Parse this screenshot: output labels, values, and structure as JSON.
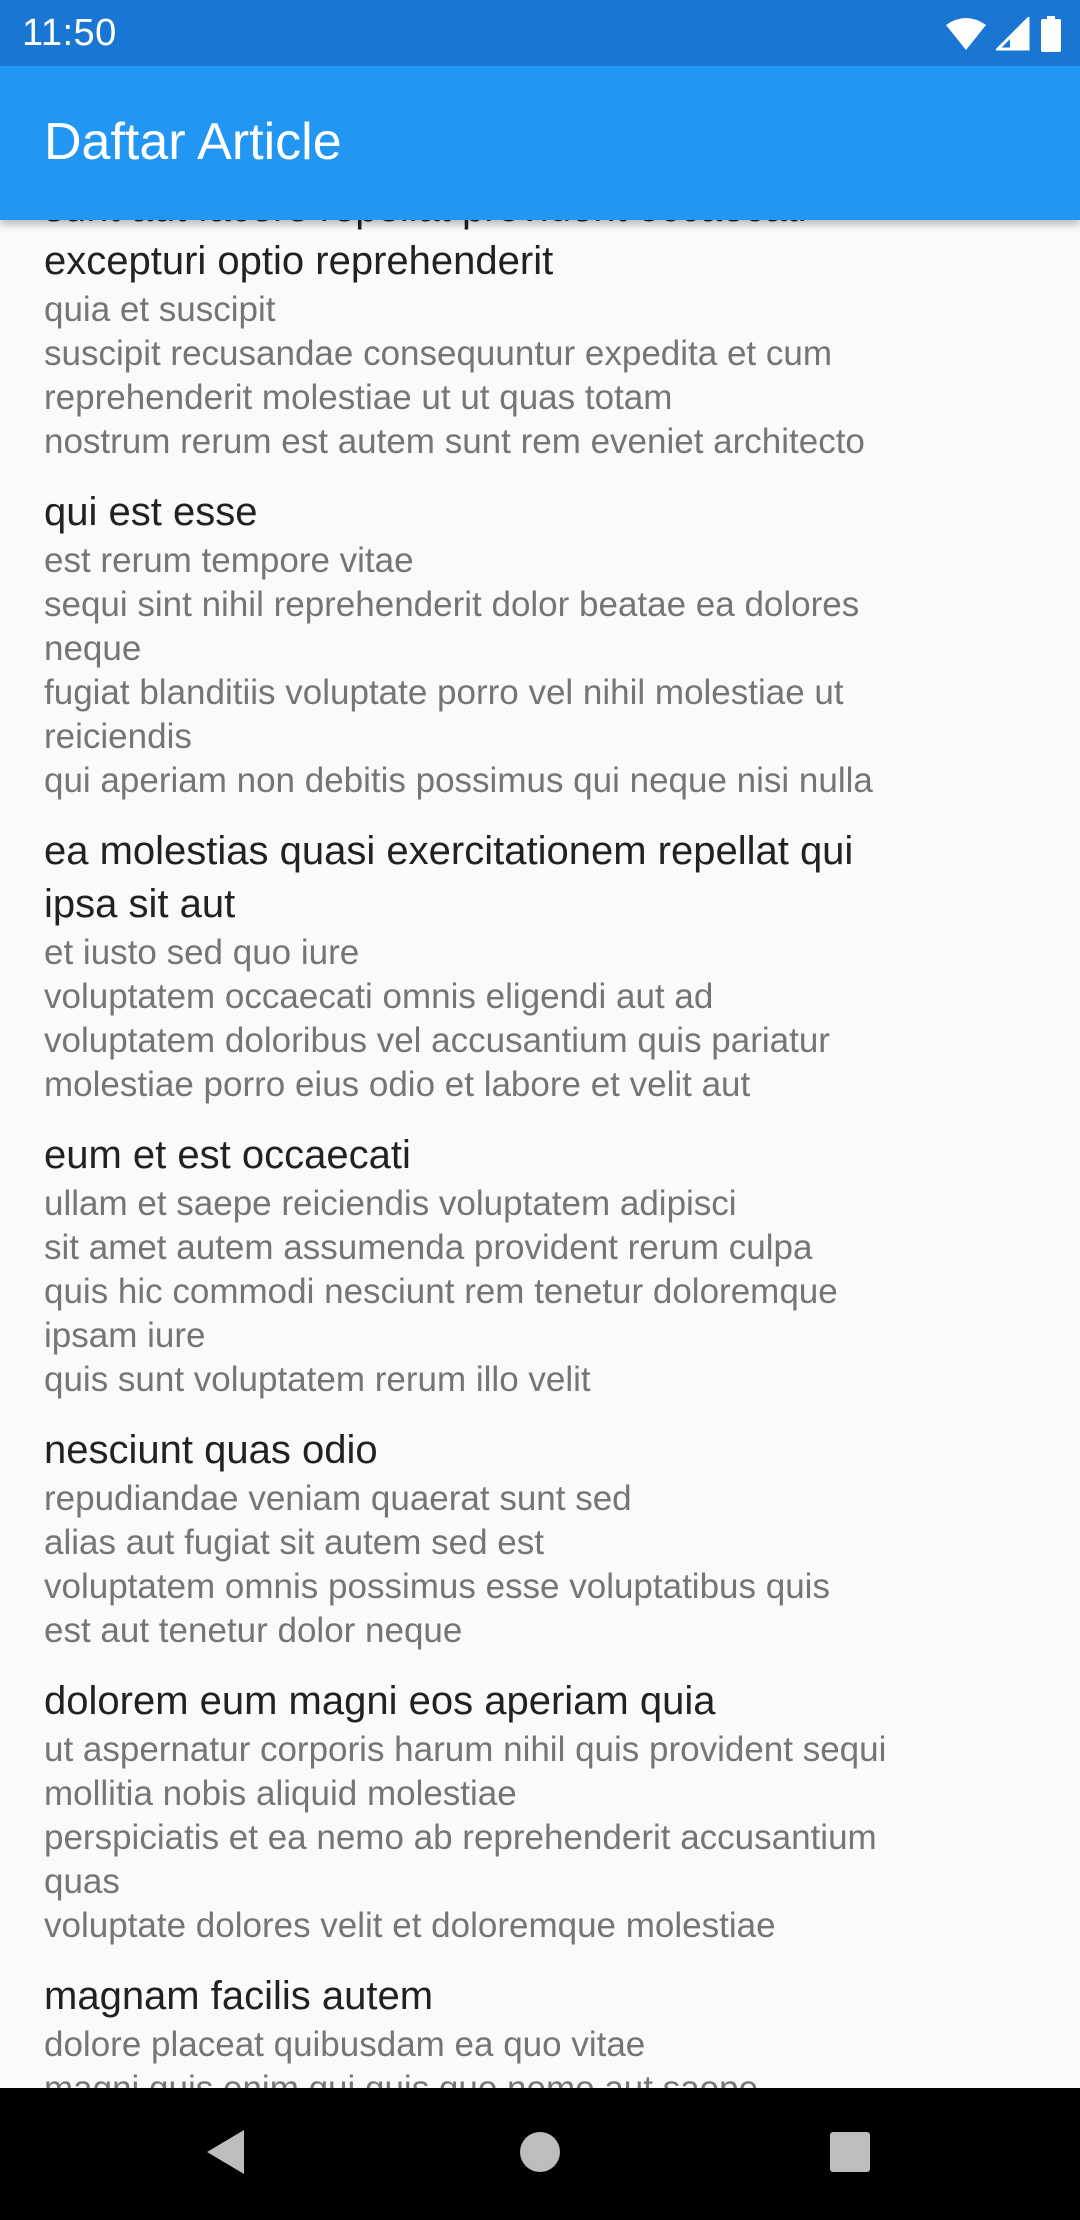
{
  "status_bar": {
    "time": "11:50",
    "icons": [
      "wifi-icon",
      "signal-icon",
      "battery-icon"
    ]
  },
  "app_bar": {
    "title": "Daftar Article"
  },
  "articles": [
    {
      "title": "sunt aut facere repellat provident occaecati\nexcepturi optio reprehenderit",
      "body": "quia et suscipit\nsuscipit recusandae consequuntur expedita et cum\nreprehenderit molestiae ut ut quas totam\nnostrum rerum est autem sunt rem eveniet architecto"
    },
    {
      "title": "qui est esse",
      "body": "est rerum tempore vitae\nsequi sint nihil reprehenderit dolor beatae ea dolores\nneque\nfugiat blanditiis voluptate porro vel nihil molestiae ut\nreiciendis\nqui aperiam non debitis possimus qui neque nisi nulla"
    },
    {
      "title": "ea molestias quasi exercitationem repellat qui\nipsa sit aut",
      "body": "et iusto sed quo iure\nvoluptatem occaecati omnis eligendi aut ad\nvoluptatem doloribus vel accusantium quis pariatur\nmolestiae porro eius odio et labore et velit aut"
    },
    {
      "title": "eum et est occaecati",
      "body": "ullam et saepe reiciendis voluptatem adipisci\nsit amet autem assumenda provident rerum culpa\nquis hic commodi nesciunt rem tenetur doloremque\nipsam iure\nquis sunt voluptatem rerum illo velit"
    },
    {
      "title": "nesciunt quas odio",
      "body": "repudiandae veniam quaerat sunt sed\nalias aut fugiat sit autem sed est\nvoluptatem omnis possimus esse voluptatibus quis\nest aut tenetur dolor neque"
    },
    {
      "title": "dolorem eum magni eos aperiam quia",
      "body": "ut aspernatur corporis harum nihil quis provident sequi\nmollitia nobis aliquid molestiae\nperspiciatis et ea nemo ab reprehenderit accusantium\nquas\nvoluptate dolores velit et doloremque molestiae"
    },
    {
      "title": "magnam facilis autem",
      "body": "dolore placeat quibusdam ea quo vitae\nmagni quis enim qui quis quo nemo aut saepe"
    }
  ],
  "nav_bar": {
    "buttons": [
      "back-icon",
      "home-icon",
      "recents-icon"
    ]
  },
  "colors": {
    "status_bar": "#1976d2",
    "app_bar": "#2196f3",
    "background": "#fafafa",
    "title_text": "#212121",
    "body_text": "#757575",
    "nav_bar": "#000000"
  }
}
